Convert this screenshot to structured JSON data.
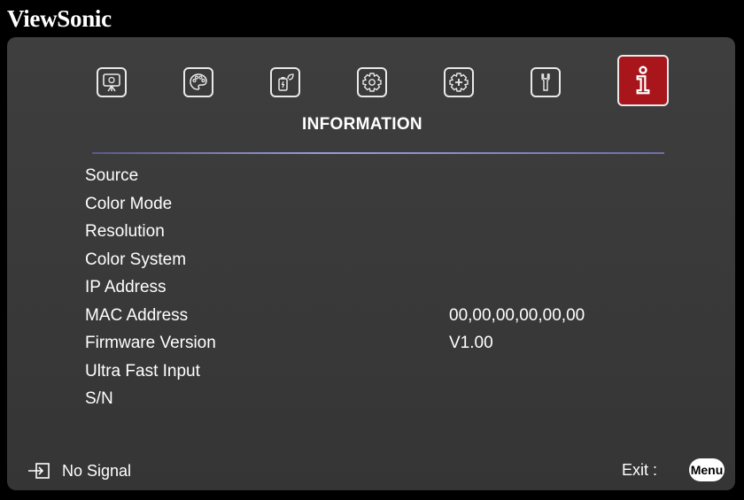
{
  "brand": "ViewSonic",
  "tabs": [
    {
      "name": "display-icon",
      "active": false
    },
    {
      "name": "palette-icon",
      "active": false
    },
    {
      "name": "power-icon",
      "active": false
    },
    {
      "name": "gear-icon",
      "active": false
    },
    {
      "name": "advanced-gear-icon",
      "active": false
    },
    {
      "name": "wrench-icon",
      "active": false
    },
    {
      "name": "info-icon",
      "active": true
    }
  ],
  "section_title": "INFORMATION",
  "rows": [
    {
      "label": "Source",
      "value": ""
    },
    {
      "label": "Color Mode",
      "value": ""
    },
    {
      "label": "Resolution",
      "value": ""
    },
    {
      "label": "Color System",
      "value": ""
    },
    {
      "label": "IP Address",
      "value": ""
    },
    {
      "label": "MAC Address",
      "value": "00,00,00,00,00,00"
    },
    {
      "label": "Firmware Version",
      "value": "V1.00"
    },
    {
      "label": "Ultra Fast Input",
      "value": ""
    },
    {
      "label": "S/N",
      "value": ""
    }
  ],
  "status": {
    "icon": "input-icon",
    "text": "No Signal"
  },
  "exit": {
    "label": "Exit :",
    "button_label": "Menu"
  },
  "colors": {
    "active_tab": "#a8151b",
    "panel": "#3a3a3a",
    "divider": "#9b9bd8"
  }
}
